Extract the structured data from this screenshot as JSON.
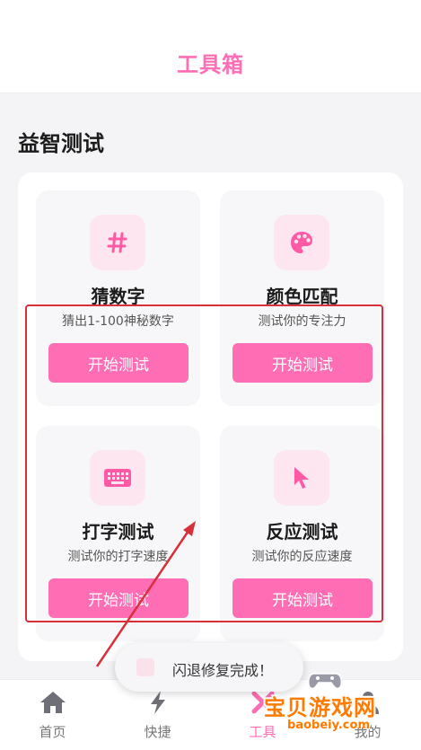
{
  "header": {
    "title": "工具箱"
  },
  "section": {
    "title": "益智测试"
  },
  "cards": [
    {
      "title": "猜数字",
      "desc": "猜出1-100神秘数字",
      "button": "开始测试",
      "icon": "hash-icon"
    },
    {
      "title": "颜色匹配",
      "desc": "测试你的专注力",
      "button": "开始测试",
      "icon": "palette-icon"
    },
    {
      "title": "打字测试",
      "desc": "测试你的打字速度",
      "button": "开始测试",
      "icon": "keyboard-icon"
    },
    {
      "title": "反应测试",
      "desc": "测试你的反应速度",
      "button": "开始测试",
      "icon": "cursor-icon"
    }
  ],
  "tabs": [
    {
      "label": "首页",
      "icon": "home-icon"
    },
    {
      "label": "快捷",
      "icon": "lightning-icon"
    },
    {
      "label": "工具",
      "icon": "tools-icon",
      "active": true
    },
    {
      "label": "我的",
      "icon": "user-icon"
    }
  ],
  "toast": {
    "text": "闪退修复完成！"
  },
  "watermark": {
    "text": "宝贝游戏网",
    "domain": "baobeiy.com"
  },
  "colors": {
    "accent": "#ff6eb4",
    "icon_bg": "#fde6ef",
    "highlight": "#d8303a"
  }
}
